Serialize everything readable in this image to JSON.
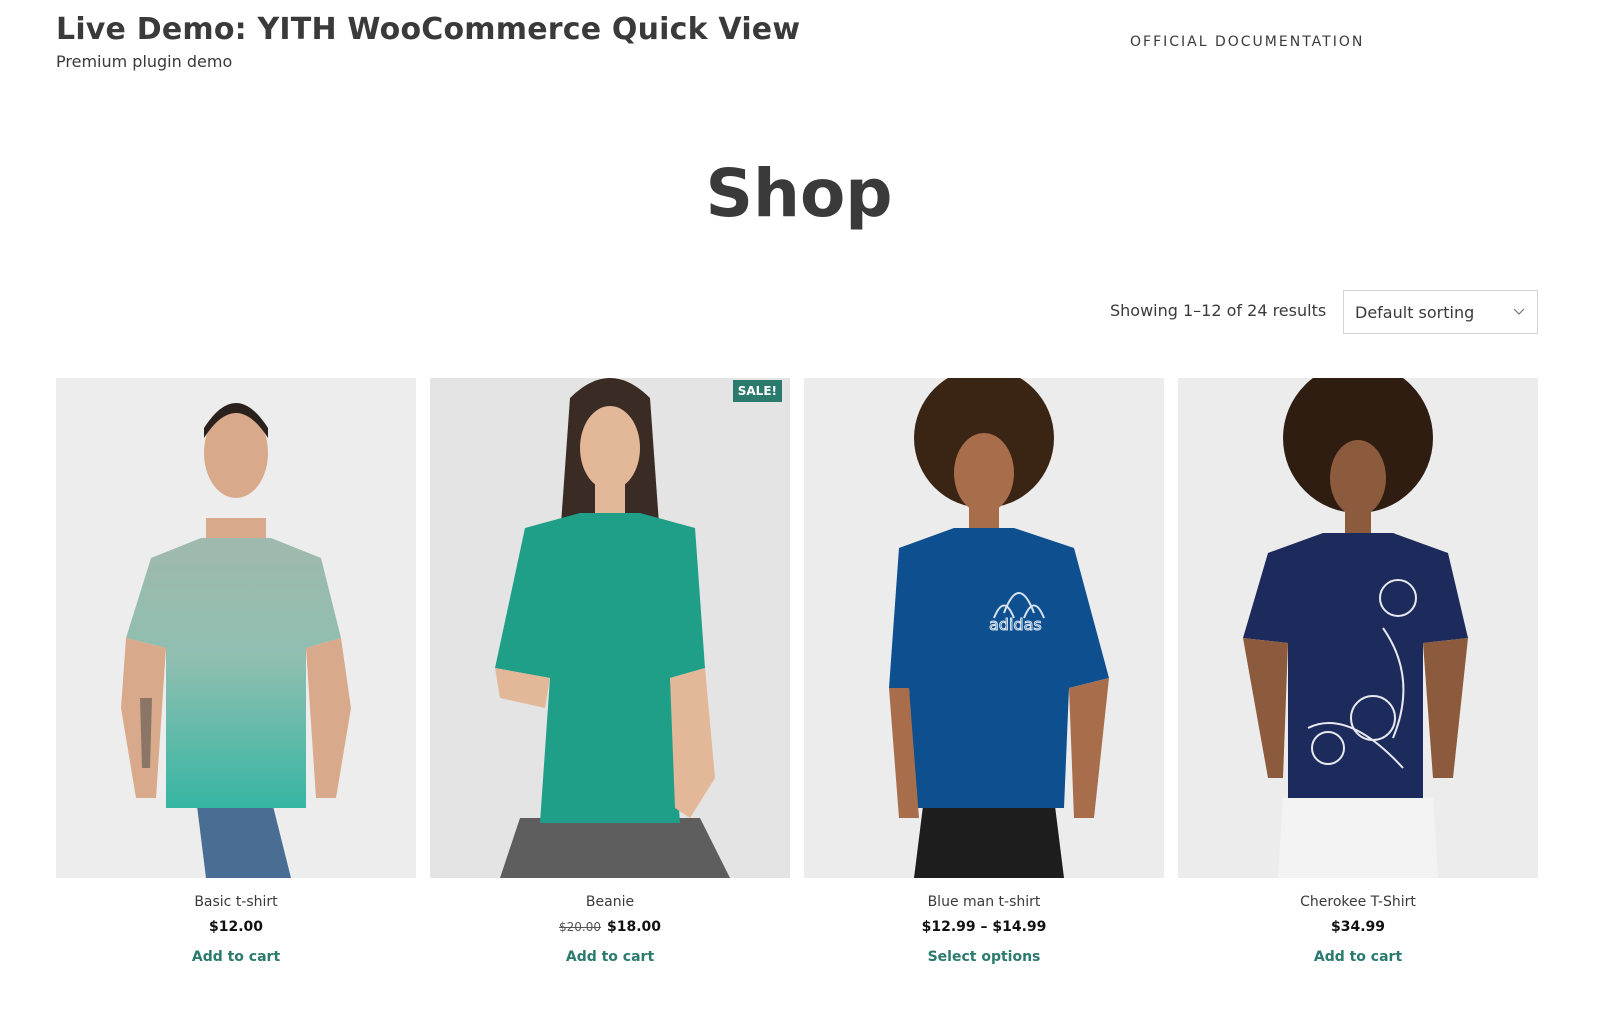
{
  "header": {
    "site_title": "Live Demo: YITH WooCommerce Quick View",
    "tagline": "Premium plugin demo",
    "nav_link": "OFFICIAL DOCUMENTATION"
  },
  "page": {
    "title": "Shop",
    "result_count": "Showing 1–12 of 24 results",
    "sorting_selected": "Default sorting"
  },
  "products": [
    {
      "name": "Basic t-shirt",
      "price": "$12.00",
      "cta": "Add to cart",
      "shirt_color": "#7fb3a6",
      "shirt_color_bottom": "#3fb5a4"
    },
    {
      "name": "Beanie",
      "price_old": "$20.00",
      "price": "$18.00",
      "badge": "SALE!",
      "cta": "Add to cart",
      "shirt_color": "#1f9e88"
    },
    {
      "name": "Blue man t-shirt",
      "price": "$12.99 – $14.99",
      "cta": "Select options",
      "shirt_color": "#0d4f8f"
    },
    {
      "name": "Cherokee T-Shirt",
      "price": "$34.99",
      "cta": "Add to cart",
      "shirt_color": "#1c2a5c"
    }
  ],
  "colors": {
    "accent": "#2b7a6e",
    "text": "#3a3a3a"
  }
}
